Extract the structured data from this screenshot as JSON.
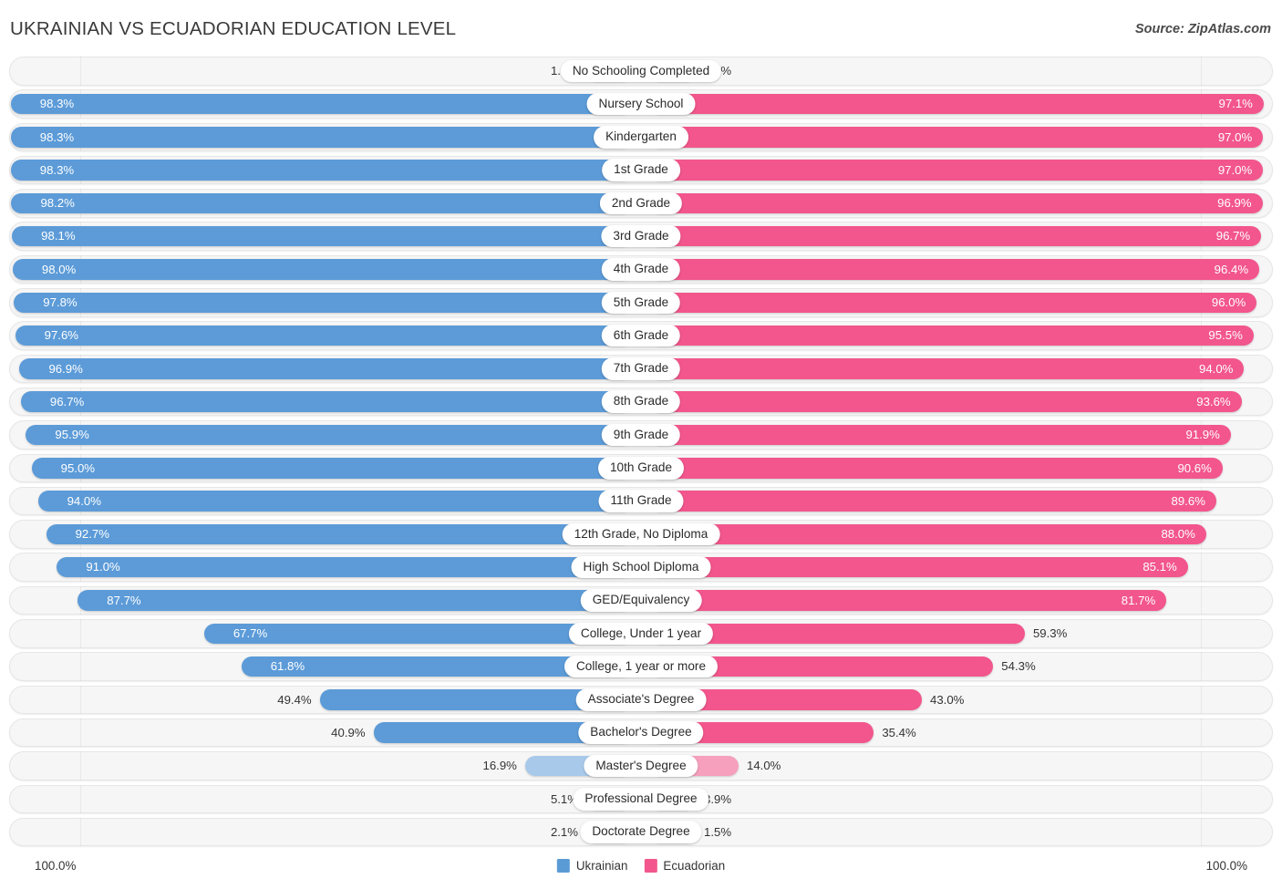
{
  "header": {
    "title": "UKRAINIAN VS ECUADORIAN EDUCATION LEVEL",
    "source": "Source: ZipAtlas.com"
  },
  "footer": {
    "axis_left": "100.0%",
    "axis_right": "100.0%",
    "legend": [
      {
        "label": "Ukrainian",
        "color": "#5B9BD5"
      },
      {
        "label": "Ecuadorian",
        "color": "#F2568C"
      }
    ]
  },
  "colors": {
    "ukrainian_strong": "#5C9BD8",
    "ukrainian_light": "#A8C9EA",
    "ecuadorian_strong": "#F2568C",
    "ecuadorian_light": "#F6A0BD",
    "track": "#f6f6f6"
  },
  "chart_data": {
    "type": "bar",
    "title": "UKRAINIAN VS ECUADORIAN EDUCATION LEVEL",
    "subtitle": "Source: ZipAtlas.com",
    "orientation": "horizontal-diverging",
    "xlabel": "",
    "ylabel": "",
    "xlim": [
      0,
      100
    ],
    "axis_left_max": "100.0%",
    "axis_right_max": "100.0%",
    "grid": false,
    "legend_position": "bottom-center",
    "categories": [
      "No Schooling Completed",
      "Nursery School",
      "Kindergarten",
      "1st Grade",
      "2nd Grade",
      "3rd Grade",
      "4th Grade",
      "5th Grade",
      "6th Grade",
      "7th Grade",
      "8th Grade",
      "9th Grade",
      "10th Grade",
      "11th Grade",
      "12th Grade, No Diploma",
      "High School Diploma",
      "GED/Equivalency",
      "College, Under 1 year",
      "College, 1 year or more",
      "Associate's Degree",
      "Bachelor's Degree",
      "Master's Degree",
      "Professional Degree",
      "Doctorate Degree"
    ],
    "series": [
      {
        "name": "Ukrainian",
        "color": "#5B9BD5",
        "values": [
          1.8,
          98.3,
          98.3,
          98.3,
          98.2,
          98.1,
          98.0,
          97.8,
          97.6,
          96.9,
          96.7,
          95.9,
          95.0,
          94.0,
          92.7,
          91.0,
          87.7,
          67.7,
          61.8,
          49.4,
          40.9,
          16.9,
          5.1,
          2.1
        ],
        "labels": [
          "1.8%",
          "98.3%",
          "98.3%",
          "98.3%",
          "98.2%",
          "98.1%",
          "98.0%",
          "97.8%",
          "97.6%",
          "96.9%",
          "96.7%",
          "95.9%",
          "95.0%",
          "94.0%",
          "92.7%",
          "91.0%",
          "87.7%",
          "67.7%",
          "61.8%",
          "49.4%",
          "40.9%",
          "16.9%",
          "5.1%",
          "2.1%"
        ]
      },
      {
        "name": "Ecuadorian",
        "color": "#F2568C",
        "values": [
          3.0,
          97.1,
          97.0,
          97.0,
          96.9,
          96.7,
          96.4,
          96.0,
          95.5,
          94.0,
          93.6,
          91.9,
          90.6,
          89.6,
          88.0,
          85.1,
          81.7,
          59.3,
          54.3,
          43.0,
          35.4,
          14.0,
          3.9,
          1.5
        ],
        "labels": [
          "3.0%",
          "97.1%",
          "97.0%",
          "97.0%",
          "96.9%",
          "96.7%",
          "96.4%",
          "96.0%",
          "95.5%",
          "94.0%",
          "93.6%",
          "91.9%",
          "90.6%",
          "89.6%",
          "88.0%",
          "85.1%",
          "81.7%",
          "59.3%",
          "54.3%",
          "43.0%",
          "35.4%",
          "14.0%",
          "3.9%",
          "1.5%"
        ]
      }
    ]
  }
}
